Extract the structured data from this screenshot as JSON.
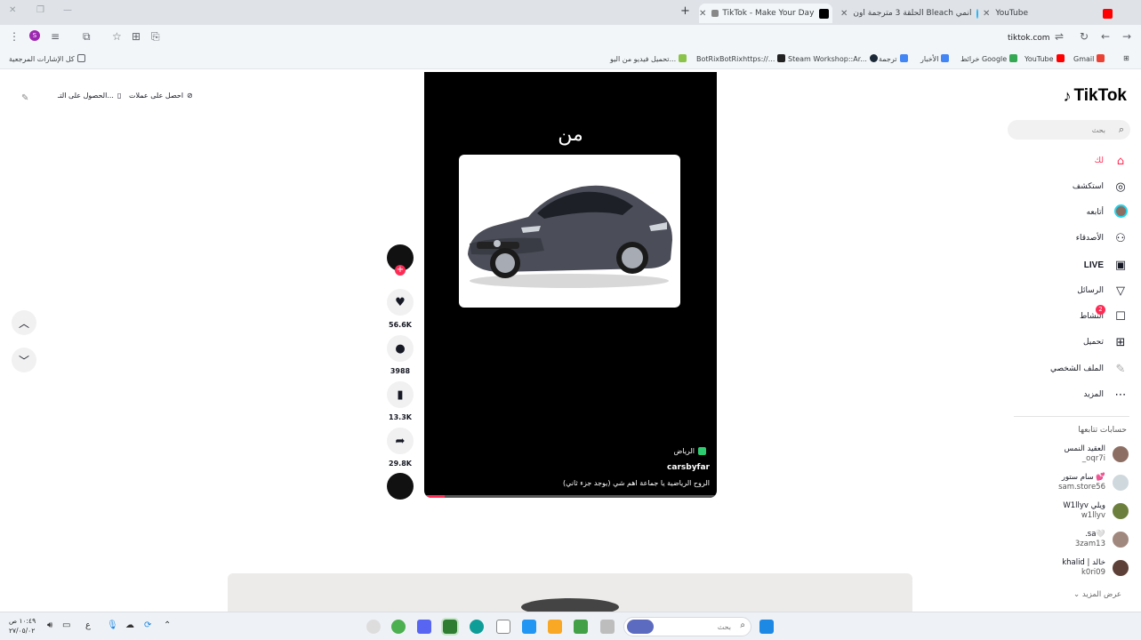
{
  "browser": {
    "tabs": [
      {
        "title": "YouTube",
        "favicon_color": "#ff0000"
      },
      {
        "title": "انمي Bleach الحلقة 3 مترجمة اون",
        "favicon_color": "#29b6f6"
      },
      {
        "title": "TikTok - Make Your Day",
        "favicon_color": "#000000"
      }
    ],
    "new_tab": "+",
    "url": "tiktok.com",
    "bookmarks": [
      {
        "label": "Gmail",
        "color": "#ea4335"
      },
      {
        "label": "YouTube",
        "color": "#ff0000"
      },
      {
        "label": "خرائط Google",
        "color": "#34a853"
      },
      {
        "label": "الأخبار",
        "color": "#4285f4"
      },
      {
        "label": "ترجمة",
        "color": "#4285f4"
      },
      {
        "label": "Steam Workshop::Ar...",
        "color": "#1b2838"
      },
      {
        "label": "BotRixBotRixhttps://...",
        "color": "#222222"
      },
      {
        "label": "تحميل فيديو من اليو...",
        "color": "#8bc34a"
      }
    ],
    "all_bookmarks": "كل الإشارات المرجعية"
  },
  "tiktok": {
    "logo": "TikTok",
    "search_placeholder": "بحث",
    "nav": [
      {
        "label": "لك",
        "icon": "home-icon"
      },
      {
        "label": "استكشف",
        "icon": "compass-icon"
      },
      {
        "label": "أتابعه",
        "icon": "avatar-icon"
      },
      {
        "label": "الأصدقاء",
        "icon": "friends-icon"
      },
      {
        "label": "LIVE",
        "icon": "live-icon"
      },
      {
        "label": "الرسائل",
        "icon": "send-icon"
      },
      {
        "label": "النشاط",
        "icon": "inbox-icon",
        "badge": "2"
      },
      {
        "label": "تحميل",
        "icon": "upload-icon"
      },
      {
        "label": "الملف الشخصي",
        "icon": "profile-icon"
      },
      {
        "label": "المزيد",
        "icon": "more-icon"
      }
    ],
    "following_title": "حسابات تتابعها",
    "following": [
      {
        "name": "العقيد النمس",
        "handle": "_oqr7i",
        "color": "#8d6e63"
      },
      {
        "name": "سام ستور 💕",
        "handle": "sam.store56",
        "color": "#cfd8dc"
      },
      {
        "name": "W1llyv ويلي",
        "handle": "w1llyv",
        "color": "#6d7f3c"
      },
      {
        "name": ".sa🤍",
        "handle": "3zam13",
        "color": "#a1887f"
      },
      {
        "name": "khalid | خالد",
        "handle": "k0ri09",
        "color": "#5d4037"
      }
    ],
    "see_more": "عرض المزيد",
    "top_buttons": [
      {
        "label": "احصل على عملات",
        "icon": "coin-icon"
      },
      {
        "label": "الحصول على التـ...",
        "icon": "phone-icon"
      }
    ],
    "video": {
      "overlay_text": "من",
      "location": "الرياض",
      "author": "carsbyfar",
      "caption": "الروح الرياضية يا جماعة اهم شي (يوجد جزء ثاني)",
      "progress": 0.07
    },
    "actions": {
      "likes": "56.6K",
      "comments": "3988",
      "saves": "13.3K",
      "shares": "29.8K"
    }
  },
  "taskbar": {
    "search_placeholder": "بحث",
    "time": "١٠:٤٩ ص",
    "date": "٢٧/٠٥/٠٢",
    "lang": "ع"
  }
}
